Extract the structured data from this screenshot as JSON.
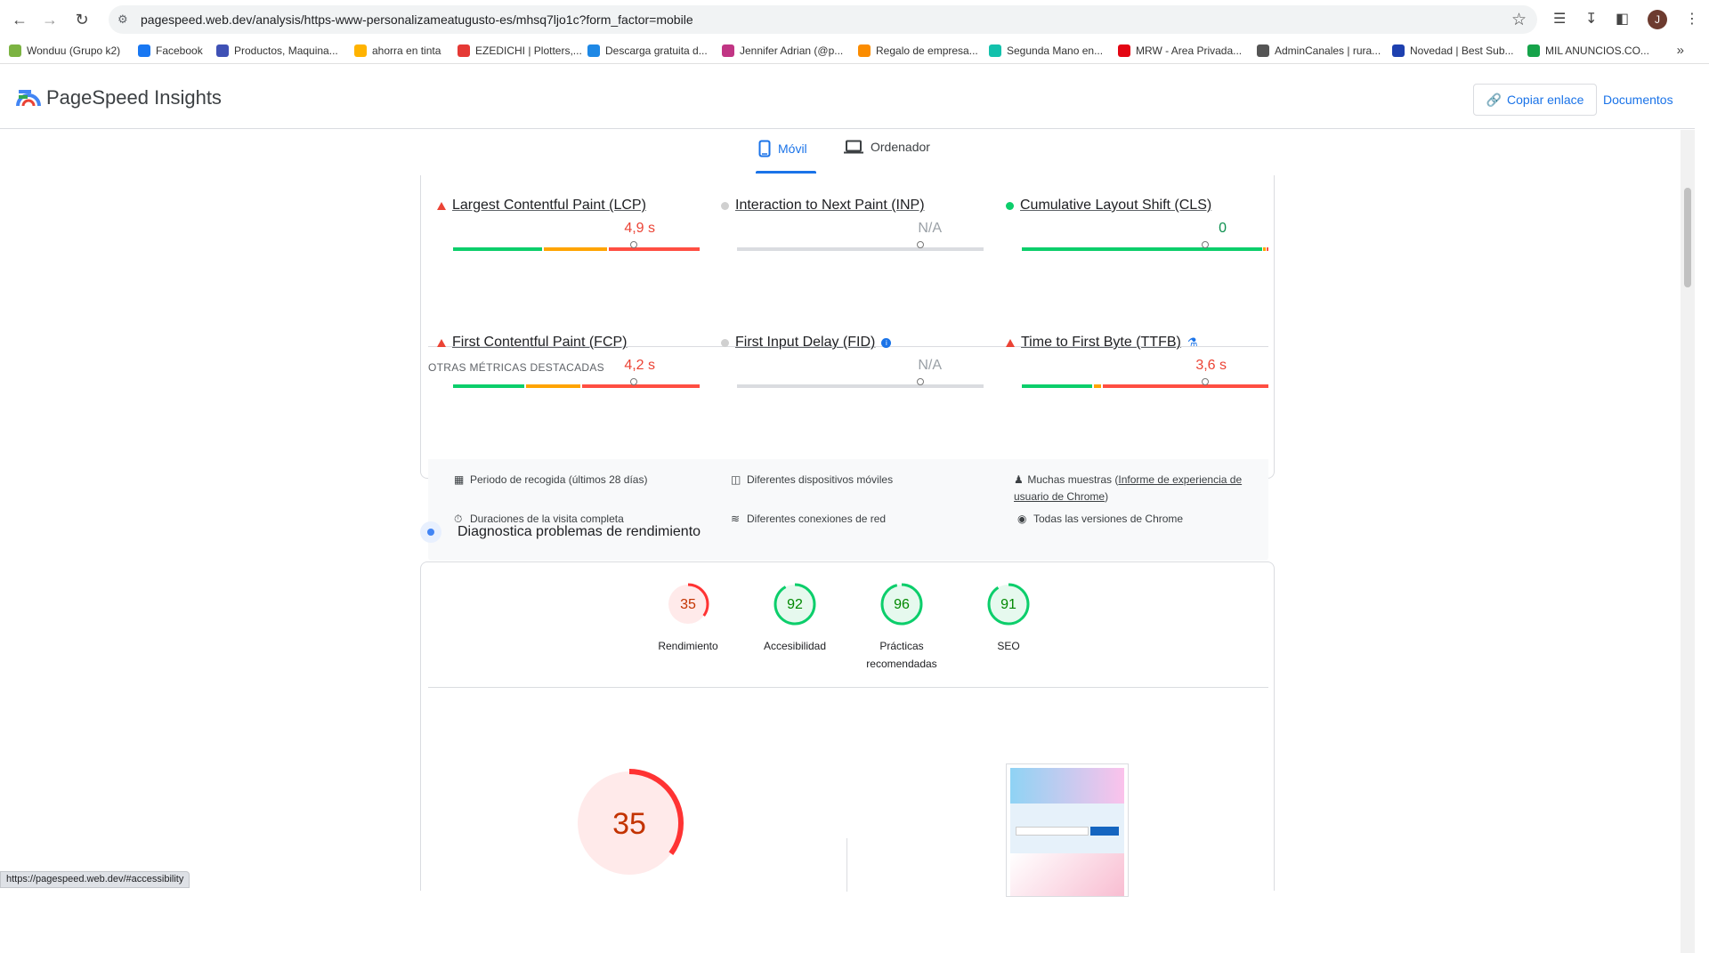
{
  "browser": {
    "url": "pagespeed.web.dev/analysis/https-www-personalizameatugusto-es/mhsq7ljo1c?form_factor=mobile",
    "profile_initial": "J",
    "bookmarks": [
      {
        "label": "Wonduu (Grupo k2)",
        "color": "#7cb342"
      },
      {
        "label": "Facebook",
        "color": "#1877f2"
      },
      {
        "label": "Productos, Maquina...",
        "color": "#3f51b5"
      },
      {
        "label": "ahorra en tinta",
        "color": "#ffb300"
      },
      {
        "label": "EZEDICHI | Plotters,...",
        "color": "#e53935"
      },
      {
        "label": "Descarga gratuita d...",
        "color": "#1e88e5"
      },
      {
        "label": "Jennifer Adrian (@p...",
        "color": "#c13584"
      },
      {
        "label": "Regalo de empresa...",
        "color": "#fb8c00"
      },
      {
        "label": "Segunda Mano en...",
        "color": "#13c1ac"
      },
      {
        "label": "MRW - Area Privada...",
        "color": "#e30613"
      },
      {
        "label": "AdminCanales | rura...",
        "color": "#555555"
      },
      {
        "label": "Novedad | Best Sub...",
        "color": "#1e40af"
      },
      {
        "label": "MIL ANUNCIOS.CO...",
        "color": "#16a34a"
      }
    ],
    "status_url": "https://pagespeed.web.dev/#accessibility"
  },
  "header": {
    "title": "PageSpeed Insights",
    "copy_link": "Copiar enlace",
    "docs": "Documentos"
  },
  "tabs": {
    "mobile": "Móvil",
    "desktop": "Ordenador"
  },
  "core_metrics": [
    {
      "name": "Largest Contentful Paint (LCP)",
      "value": "4,9 s",
      "status": "poor"
    },
    {
      "name": "Interaction to Next Paint (INP)",
      "value": "N/A",
      "status": "na"
    },
    {
      "name": "Cumulative Layout Shift (CLS)",
      "value": "0",
      "status": "good"
    }
  ],
  "other_metrics_label": "OTRAS MÉTRICAS DESTACADAS",
  "other_metrics": [
    {
      "name": "First Contentful Paint (FCP)",
      "value": "4,2 s",
      "status": "poor"
    },
    {
      "name": "First Input Delay (FID)",
      "value": "N/A",
      "status": "na"
    },
    {
      "name": "Time to First Byte (TTFB)",
      "value": "3,6 s",
      "status": "poor"
    }
  ],
  "info": {
    "period": "Periodo de recogida (últimos 28 días)",
    "devices": "Diferentes dispositivos móviles",
    "samples_prefix": "Muchas muestras (",
    "samples_link": "Informe de experiencia de usuario de Chrome",
    "samples_suffix": ")",
    "durations": "Duraciones de la visita completa",
    "connections": "Diferentes conexiones de red",
    "chrome_versions": "Todas las versiones de Chrome"
  },
  "diagnose_title": "Diagnostica problemas de rendimiento",
  "scores": [
    {
      "label": "Rendimiento",
      "value": 35,
      "color": "#ff3333",
      "bg": "#ffeaea"
    },
    {
      "label": "Accesibilidad",
      "value": 92,
      "color": "#0cce6b",
      "bg": "#e6f9ee"
    },
    {
      "label": "Prácticas recomendadas",
      "value": 96,
      "color": "#0cce6b",
      "bg": "#e6f9ee"
    },
    {
      "label": "SEO",
      "value": 91,
      "color": "#0cce6b",
      "bg": "#e6f9ee"
    }
  ],
  "big_score": 35
}
